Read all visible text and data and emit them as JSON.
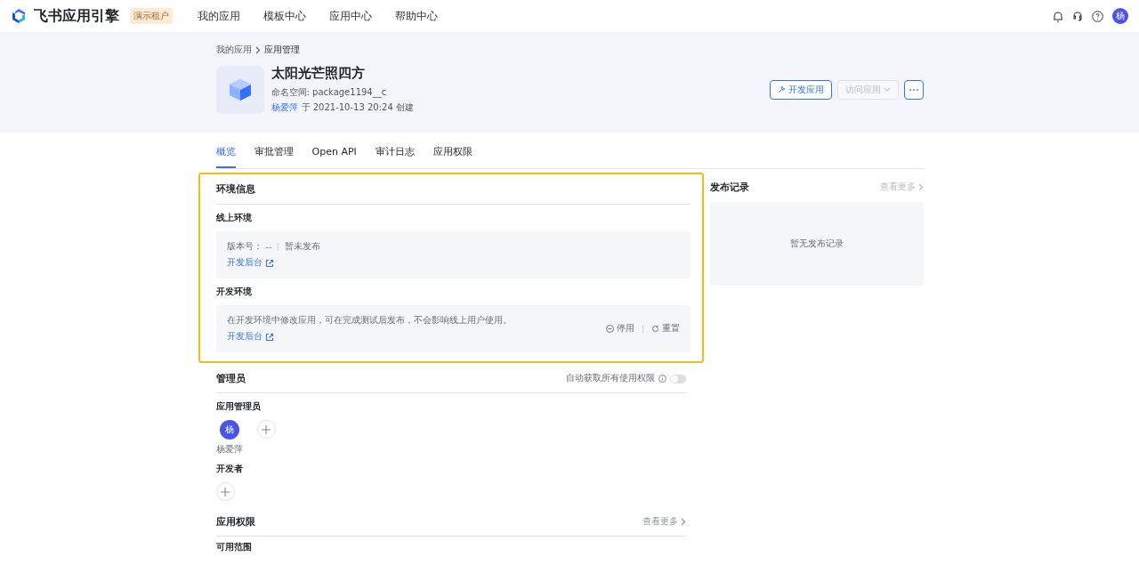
{
  "top_nav": {
    "brand": "飞书应用引擎",
    "badge": "演示租户",
    "links": [
      {
        "label": "我的应用",
        "selected": false
      },
      {
        "label": "模板中心",
        "selected": false
      },
      {
        "label": "应用中心",
        "selected": false
      },
      {
        "label": "帮助中心",
        "selected": false
      }
    ],
    "avatar": "杨"
  },
  "breadcrumb": [
    "我的应用",
    "应用管理"
  ],
  "app": {
    "name": "太阳光芒照四方",
    "namespace": "命名空间: package1194__c",
    "creator": "杨爱萍",
    "created": "于 2021-10-13 20:24 创建"
  },
  "actions": [
    {
      "label": "开发应用",
      "kind": "primary",
      "disabled": false
    },
    {
      "label": "访问应用",
      "kind": "dropdown",
      "disabled": true
    }
  ],
  "tabs": [
    {
      "label": "概览",
      "selected": true
    },
    {
      "label": "审批管理",
      "selected": false
    },
    {
      "label": "Open API",
      "selected": false
    },
    {
      "label": "审计日志",
      "selected": false
    },
    {
      "label": "应用权限",
      "selected": false
    }
  ],
  "environment": {
    "title": "环境信息",
    "online": {
      "title": "线上环境",
      "version_label": "版本号：",
      "version": "--",
      "status": "暂未发布",
      "link": "开发后台"
    },
    "dev": {
      "title": "开发环境",
      "description": "在开发环境中修改应用，可在完成测试后发布，不会影响线上用户使用。",
      "link": "开发后台",
      "actions": [
        {
          "label": "停用",
          "kind": "stop"
        },
        {
          "label": "重置",
          "kind": "reset"
        }
      ]
    }
  },
  "release_log": {
    "title": "发布记录",
    "more": "查看更多",
    "empty": "暂无发布记录"
  },
  "admins": {
    "title": "管理员",
    "toggle_label": "自动获取所有使用权限",
    "toggle_on": false,
    "groups": [
      {
        "title": "应用管理员",
        "members": [
          {
            "initial": "杨",
            "name": "杨爱萍"
          }
        ]
      },
      {
        "title": "开发者"
      }
    ]
  },
  "permissions": {
    "title": "应用权限",
    "more": "查看更多",
    "sub": "可用范围"
  }
}
